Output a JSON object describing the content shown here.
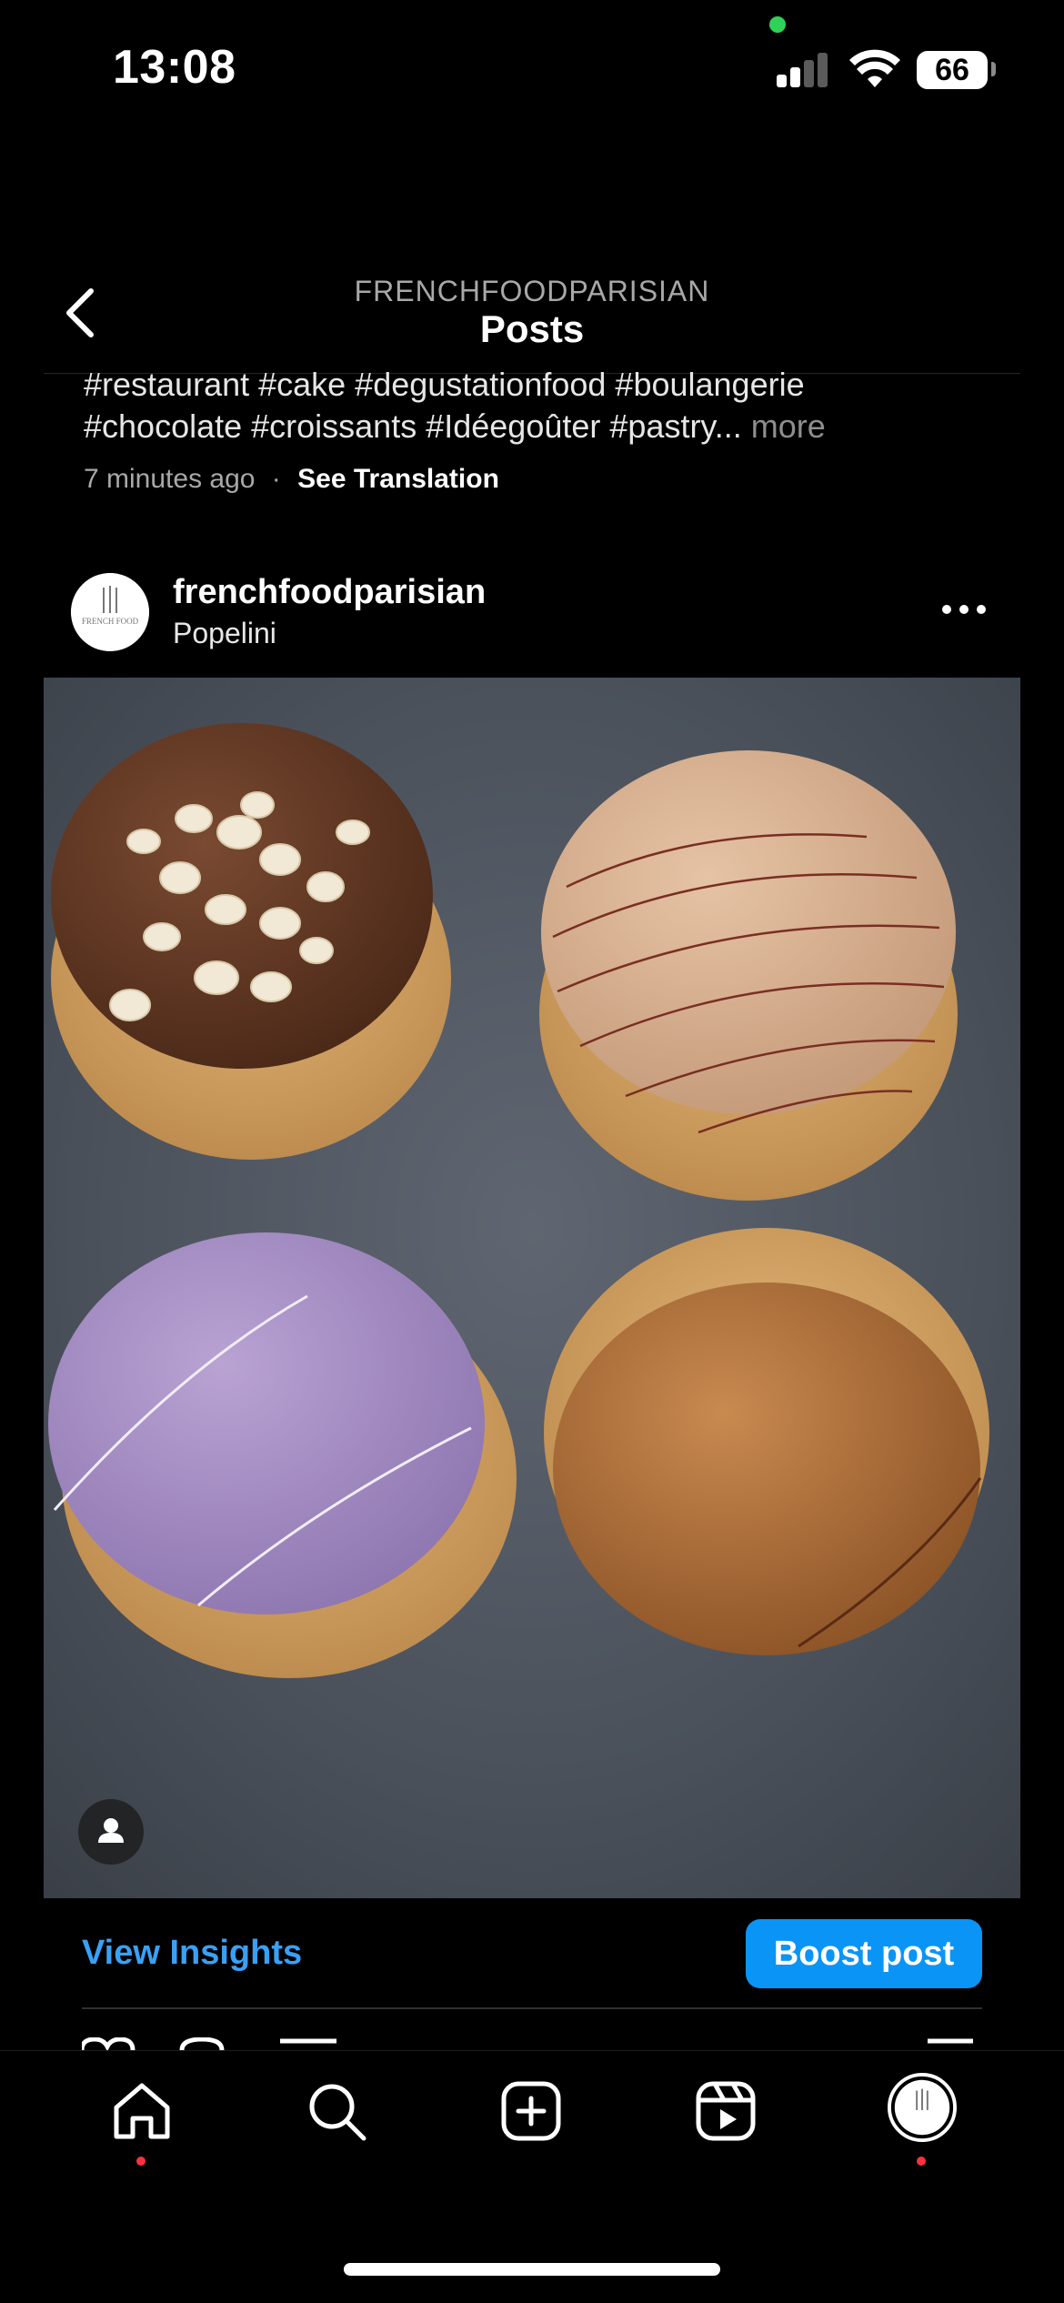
{
  "status_bar": {
    "time": "13:08",
    "battery": "66",
    "icons": [
      "signal-icon",
      "wifi-icon",
      "battery-icon"
    ]
  },
  "header": {
    "account": "FRENCHFOODPARISIAN",
    "title": "Posts",
    "back_icon": "chevron-left-icon"
  },
  "previous_post": {
    "caption_line1": "#restaurant #cake #degustationfood #boulangerie",
    "caption_line2": "#chocolate #croissants #Idéegoûter #pastry...",
    "more": " more",
    "time_ago": "7 minutes ago",
    "separator": "·",
    "see_translation": "See Translation"
  },
  "post": {
    "username": "frenchfoodparisian",
    "location": "Popelini",
    "avatar_text": "FRENCH FOOD",
    "options_icon": "more-horizontal-icon",
    "image_description_icon": "person-tag-icon"
  },
  "insights": {
    "view_insights": "View Insights",
    "boost_post": "Boost post"
  },
  "tab_bar": {
    "items": [
      {
        "name": "home",
        "icon": "home-icon",
        "has_dot": true
      },
      {
        "name": "search",
        "icon": "search-icon",
        "has_dot": false
      },
      {
        "name": "create",
        "icon": "plus-square-icon",
        "has_dot": false
      },
      {
        "name": "reels",
        "icon": "reels-icon",
        "has_dot": false
      },
      {
        "name": "profile",
        "icon": "profile-avatar",
        "has_dot": true
      }
    ]
  },
  "colors": {
    "background": "#000000",
    "accent": "#0a95f6",
    "link": "#3aa0f5",
    "notification": "#ff3040"
  }
}
